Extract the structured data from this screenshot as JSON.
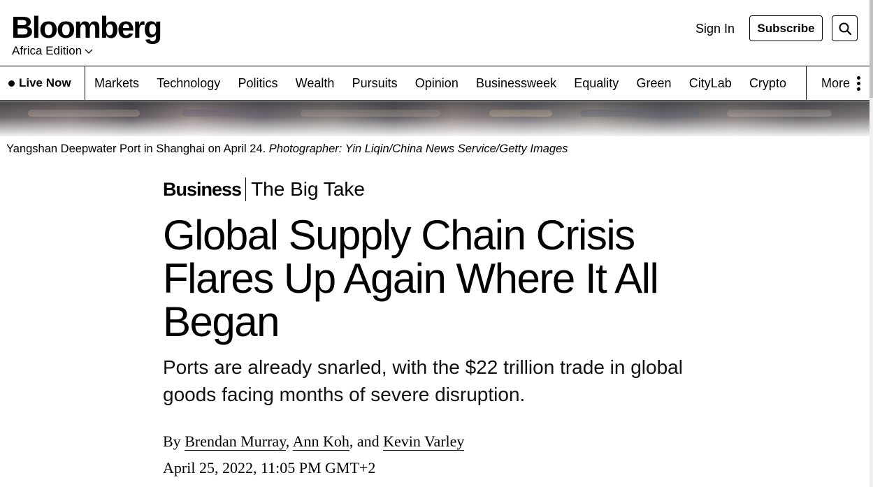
{
  "header": {
    "logo": "Bloomberg",
    "edition": "Africa Edition",
    "sign_in": "Sign In",
    "subscribe": "Subscribe"
  },
  "nav": {
    "live_now": "Live Now",
    "items": [
      "Markets",
      "Technology",
      "Politics",
      "Wealth",
      "Pursuits",
      "Opinion",
      "Businessweek",
      "Equality",
      "Green",
      "CityLab",
      "Crypto"
    ],
    "more": "More"
  },
  "hero": {
    "caption": "Yangshan Deepwater Port in Shanghai on April 24.",
    "credit": "Photographer: Yin Liqin/China News Service/Getty Images"
  },
  "article": {
    "section": "Business",
    "series": "The Big Take",
    "headline": "Global Supply Chain Crisis Flares Up Again Where It All Began",
    "dek": "Ports are already snarled, with the $22 trillion trade in global goods facing months of severe disruption.",
    "byline_prefix": "By",
    "authors": [
      "Brendan Murray",
      "Ann Koh",
      "Kevin Varley"
    ],
    "author_sep_1": ",",
    "author_sep_2": ", and",
    "date": "April 25, 2022, 11:05 PM GMT+2"
  },
  "icons": {
    "edition_chevron": "chevron-down-icon",
    "search": "search-icon",
    "live_dot": "live-dot-icon",
    "more": "kebab-icon"
  }
}
